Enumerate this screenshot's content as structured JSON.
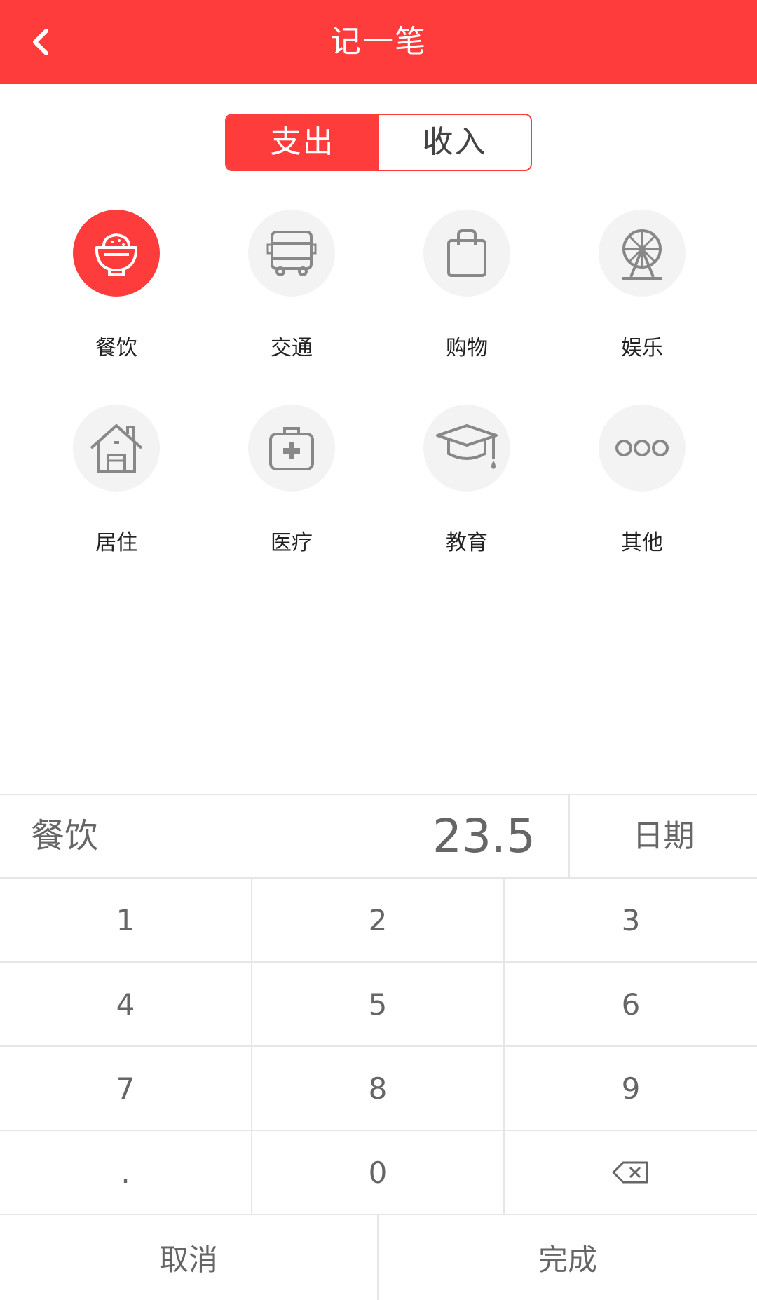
{
  "header": {
    "title": "记一笔"
  },
  "tabs": [
    {
      "label": "支出",
      "active": true
    },
    {
      "label": "收入",
      "active": false
    }
  ],
  "categories": [
    {
      "label": "餐饮",
      "icon": "rice-bowl-icon",
      "selected": true
    },
    {
      "label": "交通",
      "icon": "bus-icon",
      "selected": false
    },
    {
      "label": "购物",
      "icon": "shopping-bag-icon",
      "selected": false
    },
    {
      "label": "娱乐",
      "icon": "ferris-wheel-icon",
      "selected": false
    },
    {
      "label": "居住",
      "icon": "house-icon",
      "selected": false
    },
    {
      "label": "医疗",
      "icon": "medical-kit-icon",
      "selected": false
    },
    {
      "label": "教育",
      "icon": "graduation-cap-icon",
      "selected": false
    },
    {
      "label": "其他",
      "icon": "more-dots-icon",
      "selected": false
    }
  ],
  "entry": {
    "category": "餐饮",
    "amount": "23.5",
    "date_label": "日期"
  },
  "keys": [
    "1",
    "2",
    "3",
    "4",
    "5",
    "6",
    "7",
    "8",
    "9",
    ".",
    "0"
  ],
  "actions": {
    "cancel": "取消",
    "done": "完成"
  },
  "colors": {
    "accent": "#ff3c3c",
    "icon_gray": "#888888",
    "circle_bg": "#f3f3f3"
  }
}
